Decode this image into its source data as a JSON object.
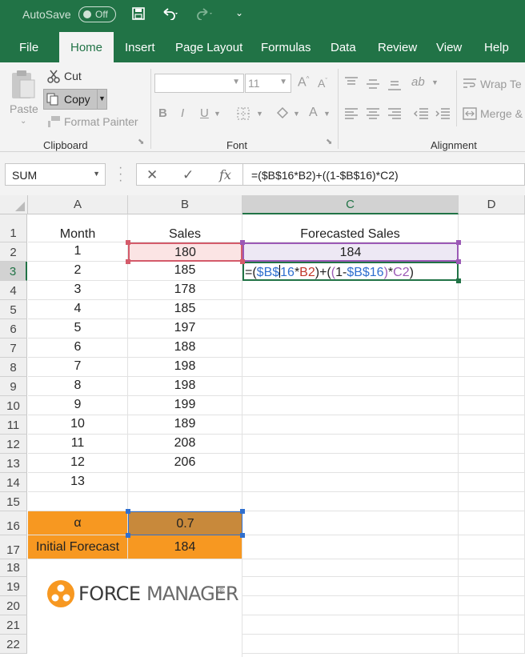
{
  "titlebar": {
    "autosave_label": "AutoSave",
    "toggle_state": "Off"
  },
  "tabs": [
    "File",
    "Home",
    "Insert",
    "Page Layout",
    "Formulas",
    "Data",
    "Review",
    "View",
    "Help"
  ],
  "active_tab": "Home",
  "ribbon": {
    "paste": "Paste",
    "cut": "Cut",
    "copy": "Copy",
    "format_painter": "Format Painter",
    "font_size": "11",
    "wrap_text": "Wrap Te",
    "merge": "Merge &",
    "groups": {
      "clipboard": "Clipboard",
      "font": "Font",
      "alignment": "Alignment"
    }
  },
  "formula_bar": {
    "name_box": "SUM",
    "formula": "=($B$16*B2)+((1-$B$16)*C2)"
  },
  "columns": [
    "A",
    "B",
    "C",
    "D"
  ],
  "rows": [
    "1",
    "2",
    "3",
    "4",
    "5",
    "6",
    "7",
    "8",
    "9",
    "10",
    "11",
    "12",
    "13",
    "14",
    "15",
    "16",
    "17",
    "18",
    "19",
    "20",
    "21",
    "22"
  ],
  "sheet": {
    "headers": {
      "month": "Month",
      "sales": "Sales",
      "forecast": "Forecasted Sales"
    },
    "months": [
      "1",
      "2",
      "3",
      "4",
      "5",
      "6",
      "7",
      "8",
      "9",
      "10",
      "11",
      "12",
      "13"
    ],
    "sales": [
      "180",
      "185",
      "178",
      "185",
      "197",
      "188",
      "198",
      "198",
      "199",
      "189",
      "208",
      "206"
    ],
    "c2": "184",
    "c3_parts": [
      {
        "t": "=(",
        "c": "#222222"
      },
      {
        "t": "$B$",
        "c": "#2f6fcf"
      },
      {
        "t": "16",
        "c": "#2f6fcf"
      },
      {
        "t": "*",
        "c": "#222222"
      },
      {
        "t": "B2",
        "c": "#c0392b"
      },
      {
        "t": ")+(",
        "c": "#222222"
      },
      {
        "t": "(",
        "c": "#9b59b6"
      },
      {
        "t": "1-",
        "c": "#222222"
      },
      {
        "t": "$B$16",
        "c": "#2f6fcf"
      },
      {
        "t": ")",
        "c": "#9b59b6"
      },
      {
        "t": "*",
        "c": "#222222"
      },
      {
        "t": "C2",
        "c": "#9b59b6"
      },
      {
        "t": ")",
        "c": "#222222"
      }
    ],
    "alpha_label": "α",
    "alpha_value": "0.7",
    "init_label": "Initial Forecast",
    "init_value": "184"
  },
  "logo": {
    "text_bold": "FORCE",
    "text_light": "MANAGER",
    "mark": "®"
  },
  "colors": {
    "excel_green": "#217346",
    "orange": "#f79821",
    "brown": "#c8893b",
    "ref_blue": "#2f6fcf",
    "ref_red": "#c0392b",
    "ref_purple": "#9b59b6"
  }
}
